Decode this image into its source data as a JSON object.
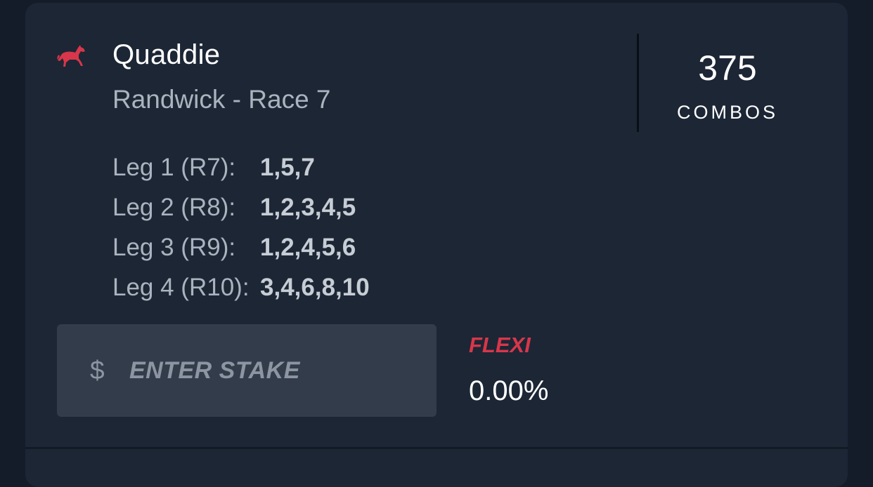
{
  "bet": {
    "title": "Quaddie",
    "subtitle": "Randwick - Race 7",
    "icon": "horse-racing-icon",
    "accent_color": "#d8364a"
  },
  "combos": {
    "count": "375",
    "label": "COMBOS"
  },
  "legs": [
    {
      "label": "Leg 1 (R7):",
      "selections": "1,5,7"
    },
    {
      "label": "Leg 2 (R8):",
      "selections": "1,2,3,4,5"
    },
    {
      "label": "Leg 3 (R9):",
      "selections": "1,2,4,5,6"
    },
    {
      "label": "Leg 4 (R10):",
      "selections": "3,4,6,8,10"
    }
  ],
  "stake": {
    "currency_symbol": "$",
    "placeholder": "ENTER STAKE"
  },
  "flexi": {
    "label": "FLEXI",
    "value": "0.00%"
  }
}
